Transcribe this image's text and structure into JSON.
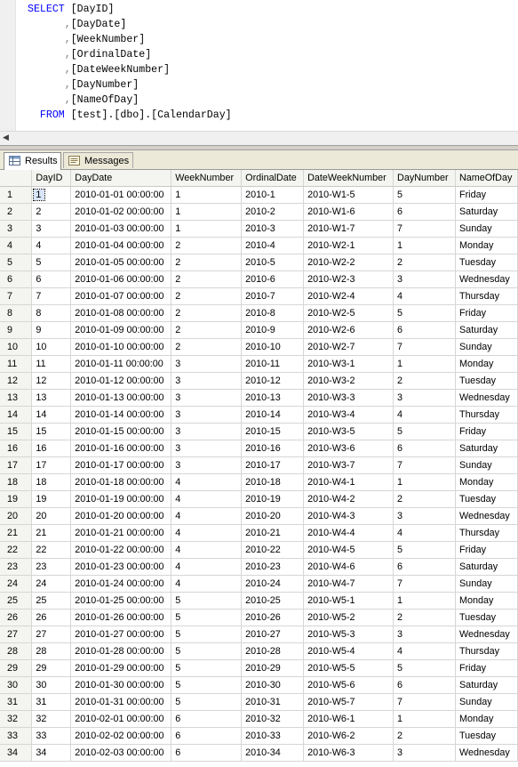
{
  "query": {
    "lines": [
      {
        "kw": "SELECT",
        "text": " [DayID]"
      },
      {
        "kw": "",
        "comma": ",",
        "text": "[DayDate]"
      },
      {
        "kw": "",
        "comma": ",",
        "text": "[WeekNumber]"
      },
      {
        "kw": "",
        "comma": ",",
        "text": "[OrdinalDate]"
      },
      {
        "kw": "",
        "comma": ",",
        "text": "[DateWeekNumber]"
      },
      {
        "kw": "",
        "comma": ",",
        "text": "[DayNumber]"
      },
      {
        "kw": "",
        "comma": ",",
        "text": "[NameOfDay]"
      },
      {
        "kw": "FROM",
        "text": " [test].[dbo].[CalendarDay]"
      }
    ]
  },
  "tabs": {
    "results": "Results",
    "messages": "Messages"
  },
  "grid": {
    "columns": [
      "",
      "DayID",
      "DayDate",
      "WeekNumber",
      "OrdinalDate",
      "DateWeekNumber",
      "DayNumber",
      "NameOfDay"
    ],
    "rows": [
      [
        "1",
        "1",
        "2010-01-01 00:00:00",
        "1",
        "2010-1",
        "2010-W1-5",
        "5",
        "Friday"
      ],
      [
        "2",
        "2",
        "2010-01-02 00:00:00",
        "1",
        "2010-2",
        "2010-W1-6",
        "6",
        "Saturday"
      ],
      [
        "3",
        "3",
        "2010-01-03 00:00:00",
        "1",
        "2010-3",
        "2010-W1-7",
        "7",
        "Sunday"
      ],
      [
        "4",
        "4",
        "2010-01-04 00:00:00",
        "2",
        "2010-4",
        "2010-W2-1",
        "1",
        "Monday"
      ],
      [
        "5",
        "5",
        "2010-01-05 00:00:00",
        "2",
        "2010-5",
        "2010-W2-2",
        "2",
        "Tuesday"
      ],
      [
        "6",
        "6",
        "2010-01-06 00:00:00",
        "2",
        "2010-6",
        "2010-W2-3",
        "3",
        "Wednesday"
      ],
      [
        "7",
        "7",
        "2010-01-07 00:00:00",
        "2",
        "2010-7",
        "2010-W2-4",
        "4",
        "Thursday"
      ],
      [
        "8",
        "8",
        "2010-01-08 00:00:00",
        "2",
        "2010-8",
        "2010-W2-5",
        "5",
        "Friday"
      ],
      [
        "9",
        "9",
        "2010-01-09 00:00:00",
        "2",
        "2010-9",
        "2010-W2-6",
        "6",
        "Saturday"
      ],
      [
        "10",
        "10",
        "2010-01-10 00:00:00",
        "2",
        "2010-10",
        "2010-W2-7",
        "7",
        "Sunday"
      ],
      [
        "11",
        "11",
        "2010-01-11 00:00:00",
        "3",
        "2010-11",
        "2010-W3-1",
        "1",
        "Monday"
      ],
      [
        "12",
        "12",
        "2010-01-12 00:00:00",
        "3",
        "2010-12",
        "2010-W3-2",
        "2",
        "Tuesday"
      ],
      [
        "13",
        "13",
        "2010-01-13 00:00:00",
        "3",
        "2010-13",
        "2010-W3-3",
        "3",
        "Wednesday"
      ],
      [
        "14",
        "14",
        "2010-01-14 00:00:00",
        "3",
        "2010-14",
        "2010-W3-4",
        "4",
        "Thursday"
      ],
      [
        "15",
        "15",
        "2010-01-15 00:00:00",
        "3",
        "2010-15",
        "2010-W3-5",
        "5",
        "Friday"
      ],
      [
        "16",
        "16",
        "2010-01-16 00:00:00",
        "3",
        "2010-16",
        "2010-W3-6",
        "6",
        "Saturday"
      ],
      [
        "17",
        "17",
        "2010-01-17 00:00:00",
        "3",
        "2010-17",
        "2010-W3-7",
        "7",
        "Sunday"
      ],
      [
        "18",
        "18",
        "2010-01-18 00:00:00",
        "4",
        "2010-18",
        "2010-W4-1",
        "1",
        "Monday"
      ],
      [
        "19",
        "19",
        "2010-01-19 00:00:00",
        "4",
        "2010-19",
        "2010-W4-2",
        "2",
        "Tuesday"
      ],
      [
        "20",
        "20",
        "2010-01-20 00:00:00",
        "4",
        "2010-20",
        "2010-W4-3",
        "3",
        "Wednesday"
      ],
      [
        "21",
        "21",
        "2010-01-21 00:00:00",
        "4",
        "2010-21",
        "2010-W4-4",
        "4",
        "Thursday"
      ],
      [
        "22",
        "22",
        "2010-01-22 00:00:00",
        "4",
        "2010-22",
        "2010-W4-5",
        "5",
        "Friday"
      ],
      [
        "23",
        "23",
        "2010-01-23 00:00:00",
        "4",
        "2010-23",
        "2010-W4-6",
        "6",
        "Saturday"
      ],
      [
        "24",
        "24",
        "2010-01-24 00:00:00",
        "4",
        "2010-24",
        "2010-W4-7",
        "7",
        "Sunday"
      ],
      [
        "25",
        "25",
        "2010-01-25 00:00:00",
        "5",
        "2010-25",
        "2010-W5-1",
        "1",
        "Monday"
      ],
      [
        "26",
        "26",
        "2010-01-26 00:00:00",
        "5",
        "2010-26",
        "2010-W5-2",
        "2",
        "Tuesday"
      ],
      [
        "27",
        "27",
        "2010-01-27 00:00:00",
        "5",
        "2010-27",
        "2010-W5-3",
        "3",
        "Wednesday"
      ],
      [
        "28",
        "28",
        "2010-01-28 00:00:00",
        "5",
        "2010-28",
        "2010-W5-4",
        "4",
        "Thursday"
      ],
      [
        "29",
        "29",
        "2010-01-29 00:00:00",
        "5",
        "2010-29",
        "2010-W5-5",
        "5",
        "Friday"
      ],
      [
        "30",
        "30",
        "2010-01-30 00:00:00",
        "5",
        "2010-30",
        "2010-W5-6",
        "6",
        "Saturday"
      ],
      [
        "31",
        "31",
        "2010-01-31 00:00:00",
        "5",
        "2010-31",
        "2010-W5-7",
        "7",
        "Sunday"
      ],
      [
        "32",
        "32",
        "2010-02-01 00:00:00",
        "6",
        "2010-32",
        "2010-W6-1",
        "1",
        "Monday"
      ],
      [
        "33",
        "33",
        "2010-02-02 00:00:00",
        "6",
        "2010-33",
        "2010-W6-2",
        "2",
        "Tuesday"
      ],
      [
        "34",
        "34",
        "2010-02-03 00:00:00",
        "6",
        "2010-34",
        "2010-W6-3",
        "3",
        "Wednesday"
      ]
    ]
  },
  "colors": {
    "keyword": "#0000ff",
    "punctuation": "#808080",
    "selection": "#d8e4f8"
  }
}
